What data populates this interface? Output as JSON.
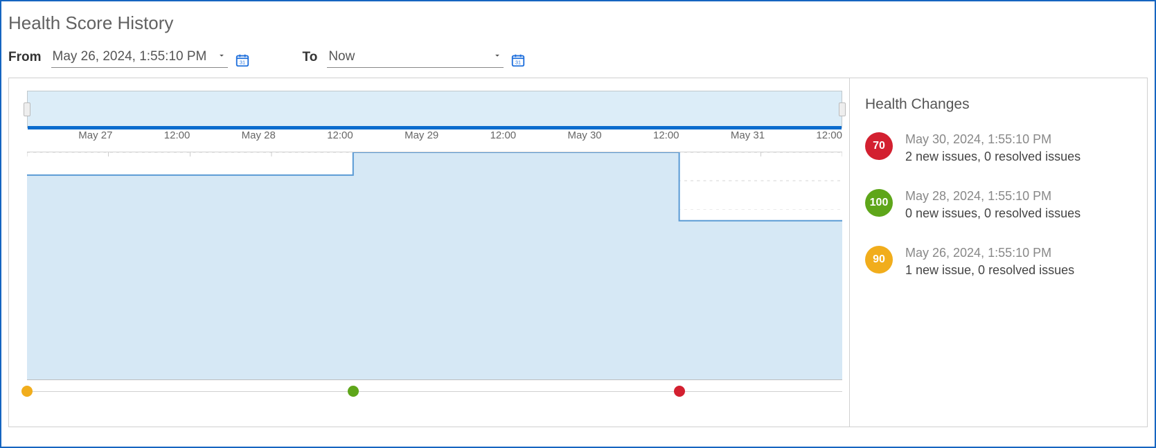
{
  "title": "Health Score History",
  "from_label": "From",
  "to_label": "To",
  "from_value": "May 26, 2024, 1:55:10 PM",
  "to_value": "Now",
  "side_title": "Health Changes",
  "changes": [
    {
      "score": "70",
      "color": "red",
      "dt": "May 30, 2024, 1:55:10 PM",
      "msg": "2 new issues, 0 resolved issues"
    },
    {
      "score": "100",
      "color": "green",
      "dt": "May 28, 2024, 1:55:10 PM",
      "msg": "0 new issues, 0 resolved issues"
    },
    {
      "score": "90",
      "color": "amber",
      "dt": "May 26, 2024, 1:55:10 PM",
      "msg": "1 new issue, 0 resolved issues"
    }
  ],
  "chart_data": {
    "type": "area",
    "ylabel": "",
    "ylim": [
      0,
      100
    ],
    "yticks": [
      25,
      50,
      75
    ],
    "x_range": [
      "2024-05-26T13:55:10",
      "2024-05-31T13:55:10"
    ],
    "x_ticks": [
      "May 27",
      "12:00",
      "May 28",
      "12:00",
      "May 29",
      "12:00",
      "May 30",
      "12:00",
      "May 31",
      "12:00"
    ],
    "series": [
      {
        "name": "Health Score",
        "points": [
          {
            "t": "2024-05-26T13:55:10",
            "v": 90
          },
          {
            "t": "2024-05-28T13:55:10",
            "v": 90
          },
          {
            "t": "2024-05-28T13:55:10",
            "v": 100
          },
          {
            "t": "2024-05-30T13:55:10",
            "v": 100
          },
          {
            "t": "2024-05-30T13:55:10",
            "v": 70
          },
          {
            "t": "2024-05-31T13:55:10",
            "v": 70
          }
        ]
      }
    ],
    "events": [
      {
        "t": "2024-05-26T13:55:10",
        "score": 90,
        "color": "amber"
      },
      {
        "t": "2024-05-28T13:55:10",
        "score": 100,
        "color": "green"
      },
      {
        "t": "2024-05-30T13:55:10",
        "score": 70,
        "color": "red"
      }
    ]
  }
}
